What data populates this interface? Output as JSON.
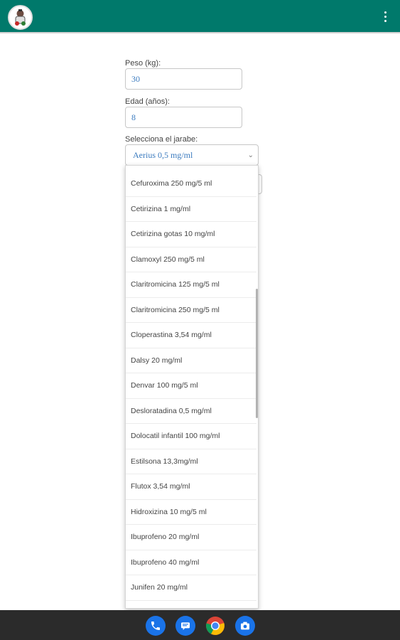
{
  "app": {
    "brand_color": "#00796b",
    "logo_icon": "app-logo-icon",
    "menu_icon": "more-vert-icon"
  },
  "form": {
    "weight": {
      "label": "Peso (kg):",
      "value": "30"
    },
    "age": {
      "label": "Edad (años):",
      "value": "8"
    },
    "syrup": {
      "label": "Selecciona el jarabe:",
      "selected": "Aerius 0,5 mg/ml"
    }
  },
  "dropdown": {
    "options": [
      "Cefuroxima 250 mg/5 ml",
      "Cetirizina 1 mg/ml",
      "Cetirizina gotas 10 mg/ml",
      "Clamoxyl 250 mg/5 ml",
      "Claritromicina 125 mg/5 ml",
      "Claritromicina 250 mg/5 ml",
      "Cloperastina 3,54 mg/ml",
      "Dalsy 20 mg/ml",
      "Denvar 100 mg/5 ml",
      "Desloratadina 0,5 mg/ml",
      "Dolocatil infantil 100 mg/ml",
      "Estilsona 13,3mg/ml",
      "Flutox 3,54 mg/ml",
      "Hidroxizina 10 mg/5 ml",
      "Ibuprofeno 20 mg/ml",
      "Ibuprofeno 40 mg/ml",
      "Junifen 20 mg/ml"
    ]
  },
  "navbar": {
    "icons": [
      "phone-icon",
      "messages-icon",
      "chrome-icon",
      "camera-icon"
    ]
  }
}
